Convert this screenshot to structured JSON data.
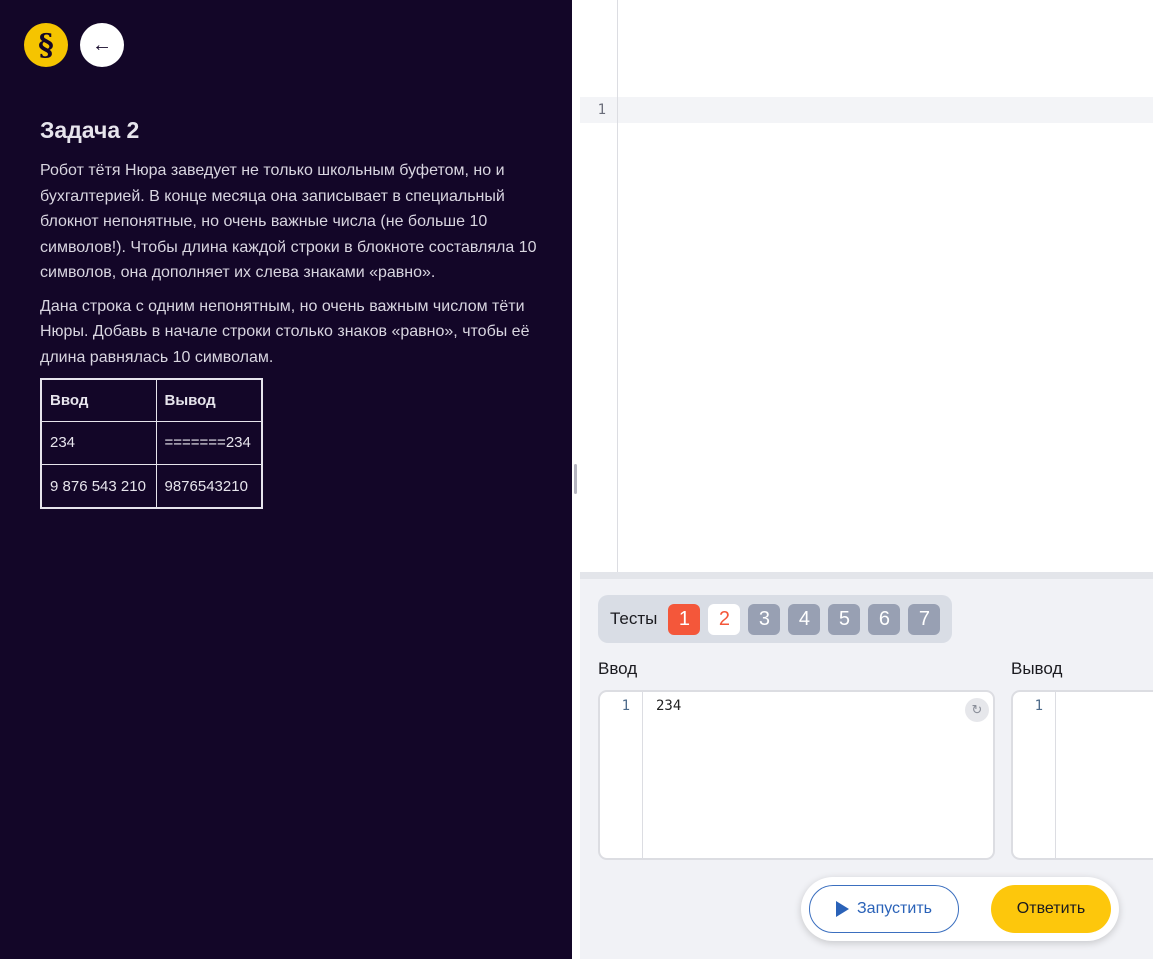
{
  "header": {
    "logo_glyph": "§",
    "back_glyph": "←"
  },
  "task": {
    "title": "Задача 2",
    "paragraph1": "Робот тётя Нюра заведует не только школьным буфетом, но и бухгалтерией. В конце месяца она записывает в специальный блокнот непонятные, но очень важные числа (не больше 10 символов!). Чтобы длина каждой строки в блокноте составляла 10 символов, она дополняет их слева знаками «равно».",
    "paragraph2": "Дана строка с одним непонятным, но очень важным числом тёти Нюры. Добавь в начале строки столько знаков «равно», чтобы её длина равнялась 10 символам.",
    "examples": {
      "headers": [
        "Ввод",
        "Вывод"
      ],
      "rows": [
        [
          "234",
          "=======234"
        ],
        [
          "9 876 543 210",
          "9876543210"
        ]
      ]
    }
  },
  "editor": {
    "line_number": "1"
  },
  "tests": {
    "label": "Тесты",
    "tabs": [
      {
        "label": "1",
        "state": "failed"
      },
      {
        "label": "2",
        "state": "current"
      },
      {
        "label": "3",
        "state": "pending"
      },
      {
        "label": "4",
        "state": "pending"
      },
      {
        "label": "5",
        "state": "pending"
      },
      {
        "label": "6",
        "state": "pending"
      },
      {
        "label": "7",
        "state": "pending"
      }
    ]
  },
  "io": {
    "input_label": "Ввод",
    "output_label": "Вывод",
    "input_line": "1",
    "input_value": "234",
    "output_line": "1",
    "output_value": "",
    "reset_glyph": "↻"
  },
  "actions": {
    "run_label": "Запустить",
    "submit_label": "Ответить"
  },
  "colors": {
    "sidebar_bg": "#130628",
    "accent_yellow": "#fdc70c",
    "failed_red": "#f4573a",
    "pending_grey": "#98a0b3",
    "run_blue": "#2a62b8"
  }
}
